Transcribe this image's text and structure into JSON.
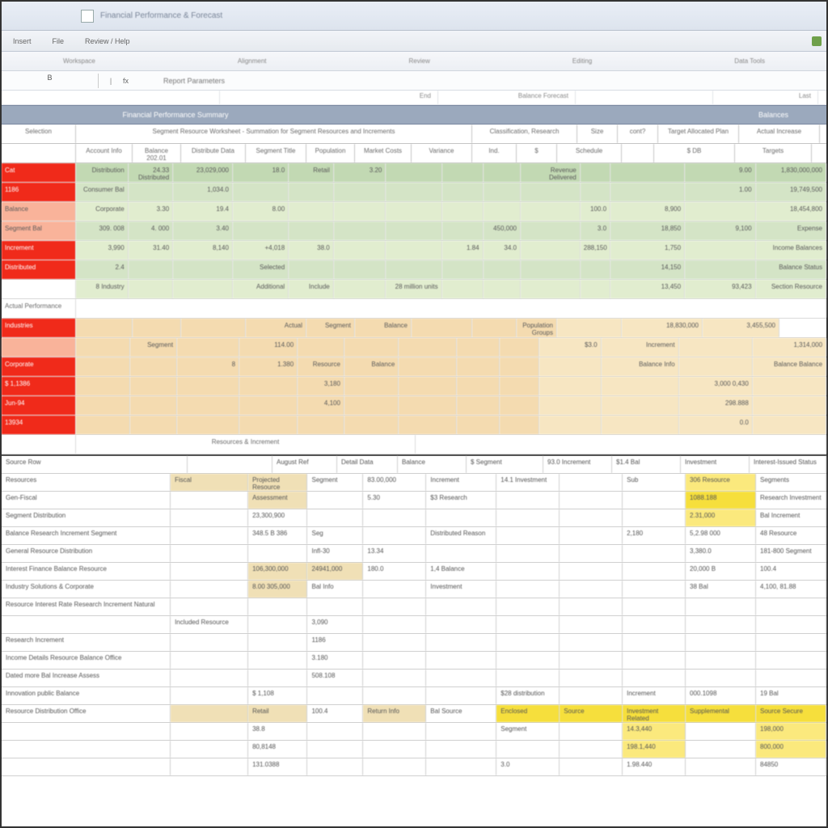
{
  "titlebar": {
    "doc_title": "Financial Performance & Forecast"
  },
  "ribbon": {
    "tabs": [
      "Insert",
      "File",
      "Review / Help"
    ],
    "group_labels": [
      "Workspace",
      "Alignment",
      "Review",
      "Editing",
      "Data Tools"
    ]
  },
  "formula_bar": {
    "name_box": "B",
    "formula_label": "Report Parameters"
  },
  "sub_header": {
    "cols": [
      "",
      "",
      "",
      "End",
      "Balance Forecast",
      "",
      "Last"
    ]
  },
  "blue_band": {
    "left_title": "Financial Performance Summary",
    "right_title": "Balances"
  },
  "main_headers": [
    "Selection",
    "Segment Resource Worksheet - Summation for Segment Resources and Increments",
    "Classification, Research",
    "Size",
    "cont?",
    "Target Allocated Plan",
    "Actual Increase"
  ],
  "main_sub_headers": [
    "",
    "Account Info",
    "Balance 202.01",
    "Distribute Data",
    "Segment Title",
    "Population",
    "Market Costs",
    "Variance",
    "Ind.",
    "$",
    "Schedule",
    "",
    "$ DB",
    "Targets"
  ],
  "main_rows": [
    {
      "left": "Cat",
      "left_bg": "red-solid",
      "cells": [
        "Distribution",
        "24.33 Distributed",
        "23,029,000",
        "18.0",
        "Retail",
        "3.20",
        "",
        "",
        "",
        "Revenue Delivered",
        "",
        "",
        "9.00",
        "1,830,000,000"
      ],
      "bg": "green-l1"
    },
    {
      "left": "1186",
      "left_bg": "red-solid",
      "cells": [
        "Consumer Bal",
        "",
        "1,034.0",
        "",
        "",
        "",
        "",
        "",
        "",
        "",
        "",
        "",
        "1.00",
        "19,749,500"
      ],
      "bg": "green-l2"
    },
    {
      "left": "Balance",
      "left_bg": "red-lt",
      "cells": [
        "Corporate",
        "3.30",
        "19.4",
        "8.00",
        "",
        "",
        "",
        "",
        "",
        "",
        "100.0",
        "8,900",
        "",
        "18,454,800"
      ],
      "bg": "green-l3"
    },
    {
      "left": "Segment Bal",
      "left_bg": "red-lt",
      "cells": [
        "309. 008",
        "4. 000",
        "3.40",
        "",
        "",
        "",
        "",
        "",
        "450,000",
        "",
        "3.0",
        "18,850",
        "9,100",
        "Expense"
      ],
      "bg": "green-l2"
    },
    {
      "left": "Increment",
      "left_bg": "red-solid",
      "cells": [
        "3,990",
        "31.40",
        "8,140",
        "+4,018",
        "38.0",
        "",
        "",
        "1.84",
        "34.0",
        "",
        "288,150",
        "1,750",
        "",
        "Income Balances"
      ],
      "bg": "green-l3"
    },
    {
      "left": "Distributed",
      "left_bg": "red-solid",
      "cells": [
        "2.4",
        "",
        "",
        "Selected",
        "",
        "",
        "",
        "",
        "",
        "",
        "",
        "14,150",
        "",
        "Balance Status"
      ],
      "bg": "green-l2"
    },
    {
      "left": "",
      "left_bg": "",
      "cells": [
        "8 Industry",
        "",
        "",
        "Additional",
        "Include",
        "",
        "28 million units",
        "",
        "",
        "",
        "",
        "13,450",
        "93,423",
        "Section Resource"
      ],
      "bg": "green-l3"
    }
  ],
  "gap_row": {
    "label": "Actual Performance",
    "cells": [
      "",
      "",
      "",
      "",
      "",
      "",
      "",
      "",
      "",
      "",
      "",
      "",
      "",
      ""
    ]
  },
  "orange_rows": [
    {
      "left": "Industries",
      "left_bg": "red-solid",
      "cells": [
        "",
        "",
        "",
        "Actual",
        "Segment",
        "Balance",
        "",
        "",
        "Population Groups",
        "",
        "18,830,000",
        "3,455,500"
      ]
    },
    {
      "left": "",
      "left_bg": "red-lt",
      "cells": [
        "",
        "Segment",
        "",
        "114.00",
        "",
        "",
        "",
        "",
        "",
        "$3.0",
        "Increment",
        "",
        "1,314,000"
      ]
    },
    {
      "left": "Corporate",
      "left_bg": "red-solid",
      "cells": [
        "",
        "",
        "8",
        "1.380",
        "Resource",
        "Balance",
        "",
        "",
        "",
        "",
        "Balance Info",
        "",
        "Balance Balance"
      ]
    },
    {
      "left": "$ 1,1386",
      "left_bg": "red-solid",
      "cells": [
        "",
        "",
        "",
        "",
        "3,180",
        "",
        "",
        "",
        "",
        "",
        "",
        "3,000 0,430",
        ""
      ]
    },
    {
      "left": "Jun-94",
      "left_bg": "red-solid",
      "cells": [
        "",
        "",
        "",
        "",
        "4,100",
        "",
        "",
        "",
        "",
        "",
        "",
        "298.888",
        ""
      ]
    },
    {
      "left": "13934",
      "left_bg": "red-solid",
      "cells": [
        "",
        "",
        "",
        "",
        "",
        "",
        "",
        "",
        "",
        "",
        "",
        "0.0",
        ""
      ]
    }
  ],
  "orange_footer": "Resources & Increment",
  "lower_header": [
    "Source Row",
    "",
    "August Ref",
    "Detail Data",
    "Balance",
    "$ Segment",
    "93.0 Increment",
    "$1.4 Bal",
    "Investment",
    "Interest-Issued Status"
  ],
  "lower_rows": [
    {
      "cells": [
        "Resources",
        "Fiscal",
        "Projected Resource",
        "Segment",
        "83.00,000",
        "Increment",
        "14.1 Investment",
        "",
        "Sub",
        "306 Resource",
        "Segments"
      ],
      "bg": [
        "",
        "tan",
        "tan",
        "",
        "",
        "",
        "",
        "",
        "",
        "yellow-lt",
        ""
      ]
    },
    {
      "cells": [
        "Gen-Fiscal",
        "",
        "Assessment",
        "",
        "5.30",
        "$3 Research",
        "",
        "",
        "",
        "1088.188",
        "Research Investment"
      ],
      "bg": [
        "",
        "",
        "tan",
        "",
        "",
        "",
        "",
        "",
        "",
        "yellow",
        ""
      ]
    },
    {
      "cells": [
        "Segment Distribution",
        "",
        "23,300,900",
        "",
        "",
        "",
        "",
        "",
        "",
        "2.31,000",
        "Bal Increment"
      ],
      "bg": [
        "",
        "",
        "",
        "",
        "",
        "",
        "",
        "",
        "",
        "yellow-lt",
        ""
      ]
    },
    {
      "cells": [
        "Balance Research Increment Segment",
        "",
        "348.5 B 386",
        "Seg",
        "",
        "Distributed Reason",
        "",
        "",
        "2,180",
        "5,2.98 000",
        "48 Resource"
      ],
      "bg": []
    },
    {
      "cells": [
        "General Resource Distribution",
        "",
        "",
        "Infl-30",
        "13.34",
        "",
        "",
        "",
        "",
        "3,380.0",
        "181-800 Segment"
      ],
      "bg": []
    },
    {
      "cells": [
        "Interest Finance Balance Resource",
        "",
        "106,300,000",
        "24941,000",
        "180.0",
        "1,4 Balance",
        "",
        "",
        "",
        "20,000 B",
        "100.4"
      ],
      "bg": [
        "",
        "",
        "tan",
        "tan",
        "",
        "",
        "",
        "",
        "",
        "",
        ""
      ]
    },
    {
      "cells": [
        "Industry Solutions & Corporate",
        "",
        "8.00 305,000",
        "Bal Info",
        "",
        "Investment",
        "",
        "",
        "",
        "38 Bal",
        "4,100, 81.88"
      ],
      "bg": [
        "",
        "",
        "tan",
        "",
        "",
        "",
        "",
        "",
        "",
        "",
        ""
      ]
    },
    {
      "cells": [
        "Resource Interest Rate Research Increment Natural",
        "",
        "",
        "",
        "",
        "",
        "",
        "",
        "",
        "",
        ""
      ],
      "bg": []
    },
    {
      "cells": [
        "",
        "Included Resource",
        "",
        "3,090",
        "",
        "",
        "",
        "",
        "",
        "",
        ""
      ],
      "bg": []
    },
    {
      "cells": [
        "Research Increment",
        "",
        "",
        "1186",
        "",
        "",
        "",
        "",
        "",
        "",
        ""
      ],
      "bg": []
    },
    {
      "cells": [
        "Income Details Resource Balance Office",
        "",
        "",
        "3.180",
        "",
        "",
        "",
        "",
        "",
        "",
        ""
      ],
      "bg": []
    },
    {
      "cells": [
        "Dated more Bal Increase Assess",
        "",
        "",
        "508.108",
        "",
        "",
        "",
        "",
        "",
        "",
        ""
      ],
      "bg": []
    },
    {
      "cells": [
        "Innovation public Balance",
        "",
        "$ 1,108",
        "",
        "",
        "",
        "$28 distribution",
        "",
        "Increment",
        "000.1098",
        "19 Bal"
      ],
      "bg": []
    },
    {
      "cells": [
        "Resource Distribution Office",
        "",
        "Retail",
        "100.4",
        "Return Info",
        "Bal Source",
        "Enclosed",
        "Source",
        "Investment Related",
        "Supplemental",
        "Source Secure"
      ],
      "bg": [
        "",
        "tan",
        "tan",
        "",
        "tan",
        "",
        "yellow",
        "yellow",
        "yellow",
        "yellow",
        "yellow"
      ]
    },
    {
      "cells": [
        "",
        "",
        "38.8",
        "",
        "",
        "",
        "Segment",
        "",
        "14.3,440",
        "",
        "198,000"
      ],
      "bg": [
        "",
        "",
        "",
        "",
        "",
        "",
        "",
        "",
        "yellow-lt",
        "",
        "yellow-lt"
      ]
    },
    {
      "cells": [
        "",
        "",
        "80,8148",
        "",
        "",
        "",
        "",
        "",
        "198.1,440",
        "",
        "800,000"
      ],
      "bg": [
        "",
        "",
        "",
        "",
        "",
        "",
        "",
        "",
        "yellow-lt",
        "",
        "yellow-lt"
      ]
    },
    {
      "cells": [
        "",
        "",
        "131.0388",
        "",
        "",
        "",
        "3.0",
        "",
        "1.98.440",
        "",
        "84850"
      ],
      "bg": [
        "",
        "",
        "",
        "",
        "",
        "",
        "",
        "",
        "",
        "",
        ""
      ]
    }
  ]
}
